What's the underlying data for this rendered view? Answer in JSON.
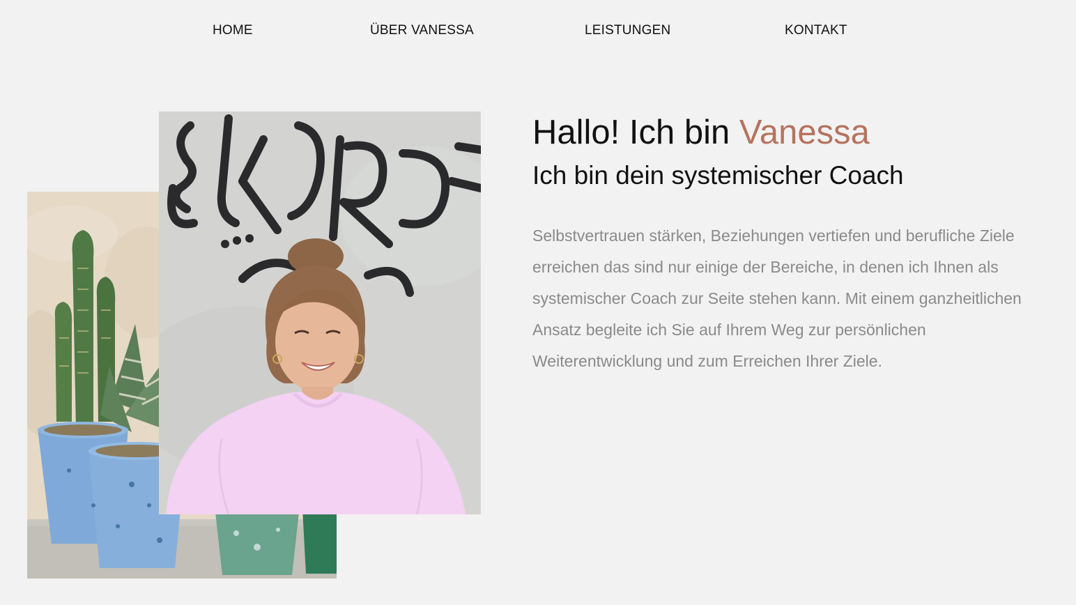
{
  "nav": {
    "items": [
      "HOME",
      "ÜBER VANESSA",
      "LEISTUNGEN",
      "KONTAKT"
    ]
  },
  "hero": {
    "headline_prefix": "Hallo! Ich bin ",
    "headline_name": "Vanessa",
    "subheadline": "Ich bin dein systemischer Coach",
    "body": "Selbstvertrauen stärken, Beziehungen vertiefen und berufliche Ziele erreichen das sind nur einige der Bereiche, in denen ich Ihnen als systemischer Coach zur Seite stehen kann. Mit einem ganzheitlichen Ansatz begleite ich Sie auf Ihrem Weg zur persönlichen Weiterentwicklung und zum Erreichen Ihrer Ziele."
  },
  "colors": {
    "background": "#f2f2f2",
    "accent": "#b5735e",
    "body_text": "#8a8a8a",
    "heading_text": "#111111"
  },
  "images": {
    "back": "cactus-plants-photo",
    "front": "portrait-photo"
  }
}
